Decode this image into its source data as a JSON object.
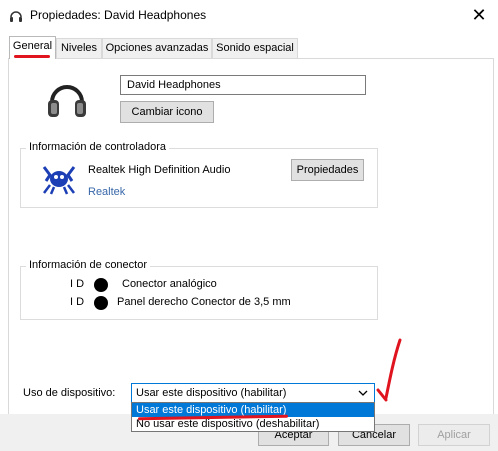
{
  "window": {
    "title": "Propiedades: David Headphones",
    "close": "✕"
  },
  "tabs": [
    {
      "label": "General"
    },
    {
      "label": "Niveles"
    },
    {
      "label": "Opciones avanzadas"
    },
    {
      "label": "Sonido espacial"
    }
  ],
  "general": {
    "device_name": "David Headphones",
    "change_icon_label": "Cambiar icono",
    "controller_group": {
      "title": "Información de controladora",
      "controller_name": "Realtek High Definition Audio",
      "vendor_link": "Realtek",
      "properties_label": "Propiedades"
    },
    "connector_group": {
      "title": "Información de conector",
      "rows": [
        {
          "id": "I D",
          "label": "Conector analógico"
        },
        {
          "id": "I D",
          "label": "Panel derecho Conector de 3,5 mm"
        }
      ]
    },
    "usage": {
      "label": "Uso de dispositivo:",
      "selected": "Usar este dispositivo (habilitar)",
      "options": [
        "Usar este dispositivo (habilitar)",
        "No usar este dispositivo (deshabilitar)"
      ]
    }
  },
  "buttons": {
    "ok": "Aceptar",
    "cancel": "Cancelar",
    "apply": "Aplicar"
  },
  "colors": {
    "accent": "#0078d7",
    "annotation": "#e0141e",
    "link": "#3767a9"
  },
  "icons": [
    "headphones-icon",
    "speaker-icon",
    "realtek-crab-icon",
    "chevron-down-icon"
  ]
}
